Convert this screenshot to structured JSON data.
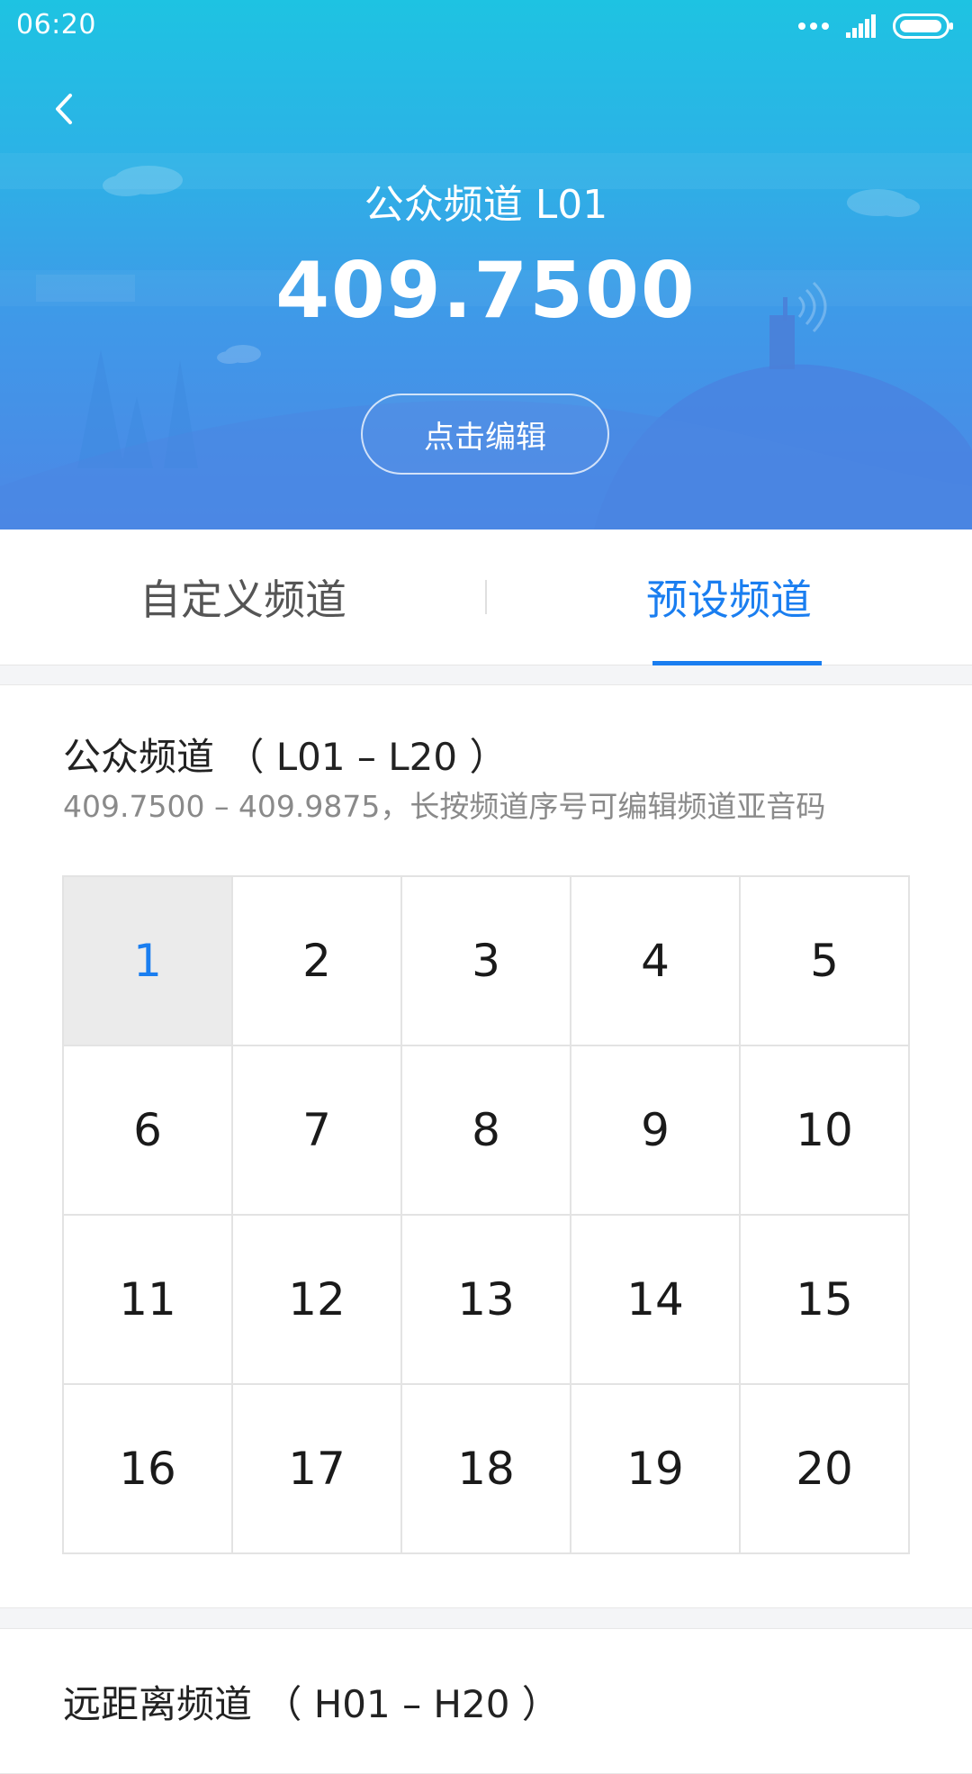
{
  "status_bar": {
    "time": "06:20",
    "icons": [
      "more-dots-icon",
      "signal-icon",
      "battery-icon"
    ]
  },
  "header": {
    "back_icon": "chevron-left-icon",
    "channel_name": "公众频道 L01",
    "frequency": "409.7500",
    "edit_label": "点击编辑"
  },
  "tabs": [
    {
      "label": "自定义频道",
      "active": false
    },
    {
      "label": "预设频道",
      "active": true
    }
  ],
  "sections": [
    {
      "title": "公众频道 （ L01 – L20 ）",
      "subtitle": "409.7500 – 409.9875，长按频道序号可编辑频道亚音码",
      "selected": "1",
      "channels": [
        "1",
        "2",
        "3",
        "4",
        "5",
        "6",
        "7",
        "8",
        "9",
        "10",
        "11",
        "12",
        "13",
        "14",
        "15",
        "16",
        "17",
        "18",
        "19",
        "20"
      ]
    },
    {
      "title": "远距离频道 （ H01 – H20 ）"
    }
  ],
  "colors": {
    "accent": "#1a7ef0",
    "hero_top": "#1ec3e2",
    "hero_bottom": "#4d87e6",
    "selected_cell_bg": "#ebebeb"
  }
}
